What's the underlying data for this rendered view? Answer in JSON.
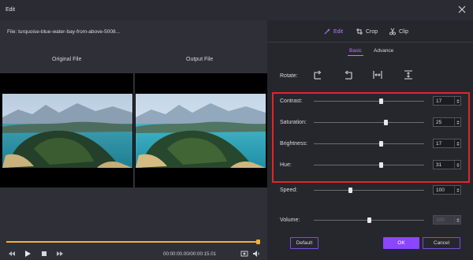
{
  "window": {
    "title": "Edit"
  },
  "file": {
    "label": "File:  turquoise-blue-water-bay-from-above-5008..."
  },
  "preview": {
    "original_label": "Original File",
    "output_label": "Output File"
  },
  "playback": {
    "timecode": "00:00:00.00/00:00:15.01",
    "progress": 1.0
  },
  "tabs": [
    {
      "label": "Edit",
      "icon": "magic-wand-icon",
      "active": true
    },
    {
      "label": "Crop",
      "icon": "crop-icon",
      "active": false
    },
    {
      "label": "Clip",
      "icon": "scissors-icon",
      "active": false
    }
  ],
  "subtabs": {
    "basic": "Basic",
    "advance": "Advance"
  },
  "rotate": {
    "label": "Rotate:"
  },
  "adjust": {
    "contrast": {
      "label": "Contrast:",
      "value": "17",
      "level": 0.61
    },
    "saturation": {
      "label": "Saturation:",
      "value": "25",
      "level": 0.65
    },
    "brightness": {
      "label": "Brightness:",
      "value": "17",
      "level": 0.61
    },
    "hue": {
      "label": "Hue:",
      "value": "31",
      "level": 0.61
    },
    "speed": {
      "label": "Speed:",
      "value": "100",
      "level": 0.33
    },
    "volume": {
      "label": "Volume:",
      "value": "100",
      "level": 0.5
    }
  },
  "buttons": {
    "default": "Default",
    "ok": "OK",
    "cancel": "Cancel"
  },
  "colors": {
    "accent": "#8c46ff",
    "highlight": "#e0262a",
    "progress": "#f3b037"
  }
}
